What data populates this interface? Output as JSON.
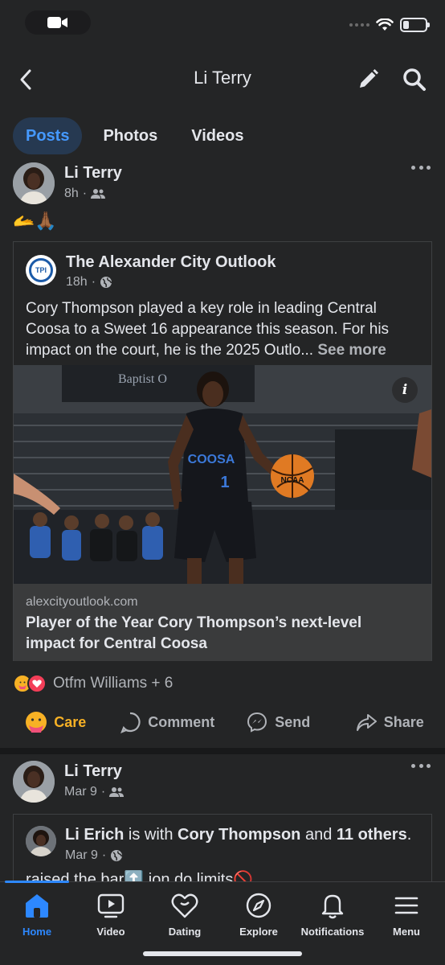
{
  "header": {
    "title": "Li Terry"
  },
  "tabs": [
    {
      "label": "Posts",
      "active": true
    },
    {
      "label": "Photos",
      "active": false
    },
    {
      "label": "Videos",
      "active": false
    }
  ],
  "post1": {
    "author": "Li Terry",
    "time": "8h",
    "audience_icon": "friends-icon",
    "text": "🫴🙏🏾",
    "shared": {
      "page_name": "The Alexander City Outlook",
      "page_logo_text": "TPI",
      "time": "18h",
      "audience_icon": "globe-icon",
      "text": "Cory Thompson played a key role in leading Central Coosa to a Sweet 16 appearance this season. For his impact on the court, he is the 2025 Outlo...",
      "see_more": "See more",
      "link_domain": "alexcityoutlook.com",
      "link_title": "Player of the Year Cory Thompson’s next-level impact for Central Coosa",
      "image": {
        "banner_text": "Baptist O",
        "jersey_text": "COOSA",
        "jersey_number": "1",
        "ball_text": "NCAA"
      }
    },
    "reactions": {
      "icons": [
        "care",
        "love"
      ],
      "label": "Otfm Williams + 6"
    },
    "actions": [
      {
        "label": "Care",
        "icon": "care-icon"
      },
      {
        "label": "Comment",
        "icon": "comment-icon"
      },
      {
        "label": "Send",
        "icon": "messenger-icon"
      },
      {
        "label": "Share",
        "icon": "share-icon"
      }
    ]
  },
  "post2": {
    "author": "Li Terry",
    "time": "Mar 9",
    "audience_icon": "friends-icon",
    "checkin": {
      "name": "Li Erich",
      "with_text": " is with ",
      "tagged": "Cory Thompson",
      "and_text": " and ",
      "others": "11 others",
      "period": ".",
      "time": "Mar 9",
      "text": "raised the bar⬆️  ion do limits🚫"
    }
  },
  "tabbar": [
    {
      "label": "Home",
      "icon": "home-icon",
      "active": true
    },
    {
      "label": "Video",
      "icon": "video-icon",
      "active": false
    },
    {
      "label": "Dating",
      "icon": "dating-icon",
      "active": false
    },
    {
      "label": "Explore",
      "icon": "explore-icon",
      "active": false
    },
    {
      "label": "Notifications",
      "icon": "bell-icon",
      "active": false
    },
    {
      "label": "Menu",
      "icon": "menu-icon",
      "active": false
    }
  ],
  "status": {
    "battery_level": 0.2
  },
  "colors": {
    "background": "#242526",
    "accent": "#2d88ff",
    "care": "#f7b125",
    "tab_active_bg": "#263951"
  }
}
